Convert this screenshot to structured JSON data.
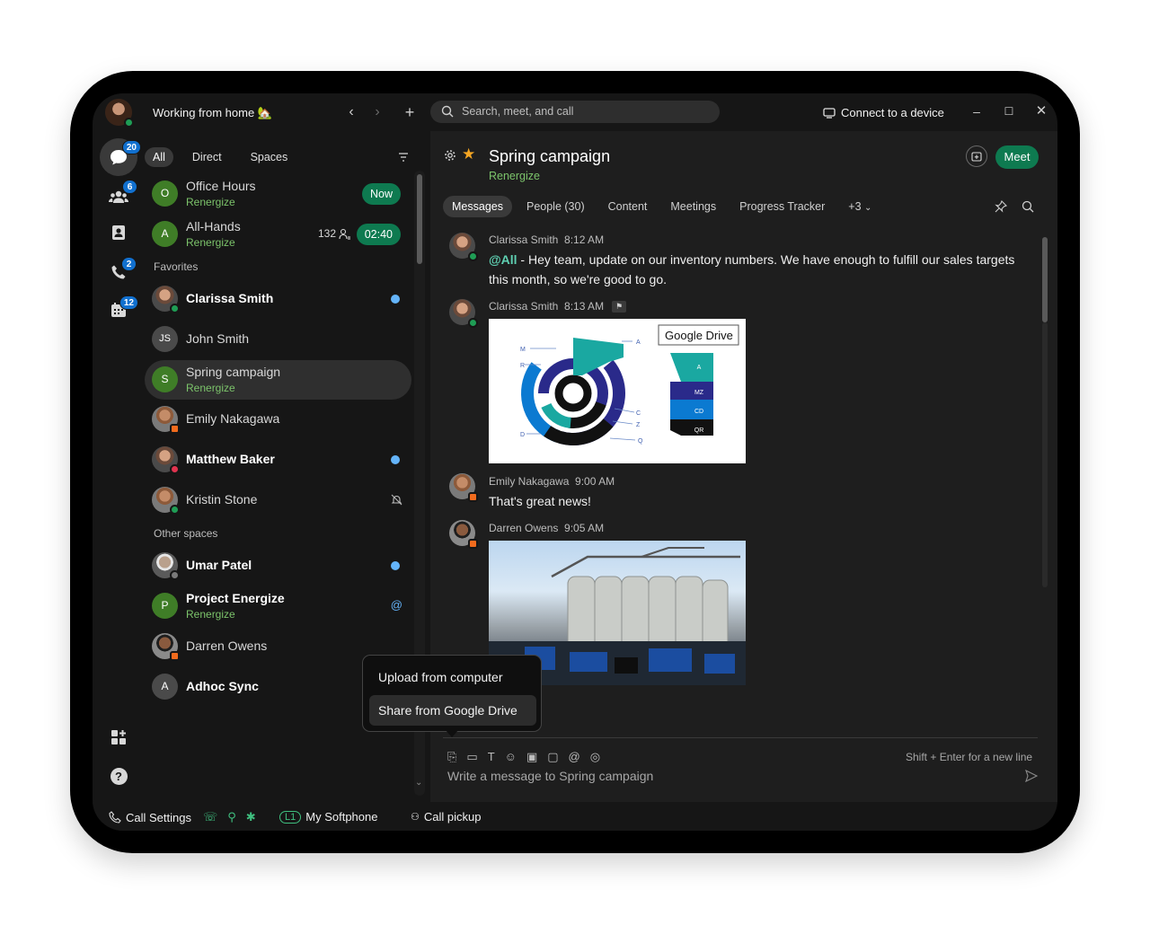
{
  "titlebar": {
    "status": "Working from home 🏡",
    "search_placeholder": "Search, meet, and call",
    "connect_label": "Connect to a device"
  },
  "rail": {
    "messaging_badge": "20",
    "teams_badge": "6",
    "calls_badge": "2",
    "meetings_badge": "12"
  },
  "filters": {
    "all": "All",
    "direct": "Direct",
    "spaces": "Spaces"
  },
  "list": {
    "office_hours": {
      "initial": "O",
      "name": "Office Hours",
      "sub": "Renergize",
      "pill": "Now"
    },
    "all_hands": {
      "initial": "A",
      "name": "All-Hands",
      "sub": "Renergize",
      "count": "132",
      "pill": "02:40"
    },
    "favorites_label": "Favorites",
    "clarissa": {
      "name": "Clarissa Smith"
    },
    "john": {
      "initial": "JS",
      "name": "John Smith"
    },
    "spring": {
      "initial": "S",
      "name": "Spring campaign",
      "sub": "Renergize"
    },
    "emily": {
      "name": "Emily Nakagawa"
    },
    "matthew": {
      "name": "Matthew Baker"
    },
    "kristin": {
      "name": "Kristin Stone"
    },
    "other_label": "Other spaces",
    "umar": {
      "name": "Umar Patel"
    },
    "project": {
      "initial": "P",
      "name": "Project Energize",
      "sub": "Renergize"
    },
    "darren": {
      "name": "Darren Owens"
    },
    "adhoc": {
      "initial": "A",
      "name": "Adhoc Sync"
    }
  },
  "space": {
    "title": "Spring campaign",
    "subtitle": "Renergize",
    "meet_label": "Meet",
    "tabs": [
      "Messages",
      "People (30)",
      "Content",
      "Meetings",
      "Progress Tracker",
      "+3"
    ]
  },
  "messages": [
    {
      "author": "Clarissa Smith",
      "time": "8:12 AM",
      "mention": "@All",
      "text": " - Hey team, update on our inventory numbers. We have enough to fulfill our sales targets this month, so we're good to go."
    },
    {
      "author": "Clarissa Smith",
      "time": "8:13 AM",
      "card_label": "Google Drive",
      "chart_labels": [
        "M",
        "R",
        "A",
        "C",
        "Z",
        "D",
        "Q"
      ],
      "stack_labels": [
        "A",
        "MZ",
        "CD",
        "QR"
      ]
    },
    {
      "author": "Emily Nakagawa",
      "time": "9:00 AM",
      "text": "That's great news!"
    },
    {
      "author": "Darren Owens",
      "time": "9:05 AM"
    }
  ],
  "popup": {
    "upload": "Upload from computer",
    "share": "Share from Google Drive"
  },
  "composer": {
    "placeholder": "Write a message to Spring campaign",
    "hint": "Shift + Enter for a new line"
  },
  "footer": {
    "call_settings": "Call Settings",
    "line_badge": "L1",
    "softphone": "My Softphone",
    "pickup": "Call pickup"
  },
  "colors": {
    "accent_green": "#0e7a50",
    "renergize_green": "#7cc46b",
    "unread_blue": "#64b4fa",
    "badge_blue": "#1170cf"
  }
}
